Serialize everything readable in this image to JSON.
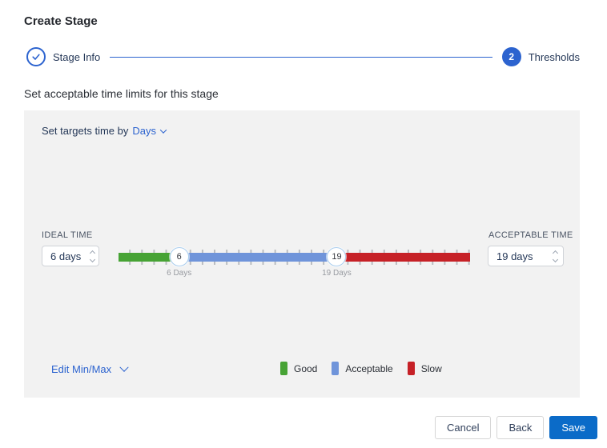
{
  "page": {
    "title": "Create Stage"
  },
  "stepper": {
    "step1": {
      "label": "Stage Info",
      "state": "completed"
    },
    "step2": {
      "label": "Thresholds",
      "number": "2",
      "state": "current"
    }
  },
  "section": {
    "subtitle": "Set acceptable time limits for this stage"
  },
  "panel": {
    "targets_prefix": "Set targets time by",
    "targets_unit": "Days",
    "ideal": {
      "label": "IDEAL TIME",
      "value": "6 days"
    },
    "acceptable": {
      "label": "ACCEPTABLE TIME",
      "value": "19 days"
    },
    "edit_minmax_label": "Edit Min/Max",
    "legend": [
      {
        "label": "Good",
        "color": "#47a335"
      },
      {
        "label": "Acceptable",
        "color": "#6f94da"
      },
      {
        "label": "Slow",
        "color": "#c62127"
      }
    ]
  },
  "slider": {
    "min": 1,
    "max": 30,
    "ideal_value": 6,
    "acceptable_value": 19,
    "ideal_handle_text": "6",
    "acceptable_handle_text": "19",
    "ideal_marker_label": "6 Days",
    "acceptable_marker_label": "19 Days",
    "colors": {
      "good": "#47a335",
      "acceptable": "#6f94da",
      "slow": "#c62127"
    }
  },
  "footer": {
    "cancel_label": "Cancel",
    "back_label": "Back",
    "save_label": "Save"
  },
  "colors": {
    "accent_blue": "#2c63cf",
    "save_blue": "#0b6bc8",
    "panel_bg": "#f2f2f2"
  }
}
